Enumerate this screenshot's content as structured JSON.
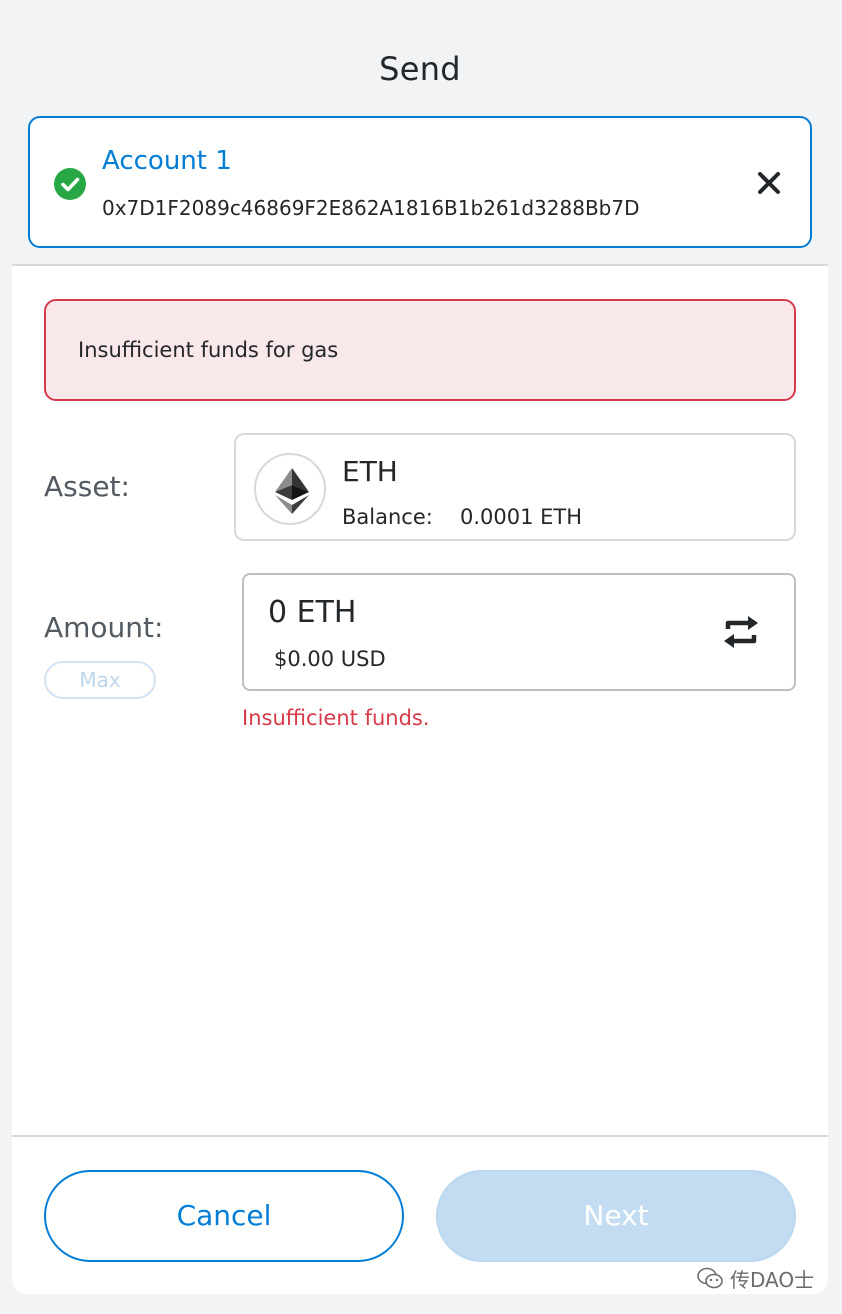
{
  "header": {
    "title": "Send",
    "account": {
      "name": "Account 1",
      "address": "0x7D1F2089c46869F2E862A1816B1b261d3288Bb7D",
      "status_icon": "check-circle-icon",
      "close_icon": "close-icon"
    }
  },
  "error_banner": {
    "text": "Insufficient funds for gas"
  },
  "asset": {
    "label": "Asset:",
    "symbol": "ETH",
    "balance_label": "Balance:",
    "balance_value": "0.0001 ETH",
    "icon": "ethereum-logo-icon"
  },
  "amount": {
    "label": "Amount:",
    "max_label": "Max",
    "value": "0 ETH",
    "fiat": "$0.00 USD",
    "swap_icon": "swap-currency-icon",
    "error": "Insufficient funds."
  },
  "footer": {
    "cancel_label": "Cancel",
    "next_label": "Next"
  },
  "watermark": {
    "text": "传DAO士",
    "icon": "wechat-icon"
  },
  "colors": {
    "accent": "#037dd6",
    "error": "#d73a49",
    "error_bg": "#f8e8ea",
    "success": "#28a745",
    "disabled_button": "#c3dcf2"
  }
}
